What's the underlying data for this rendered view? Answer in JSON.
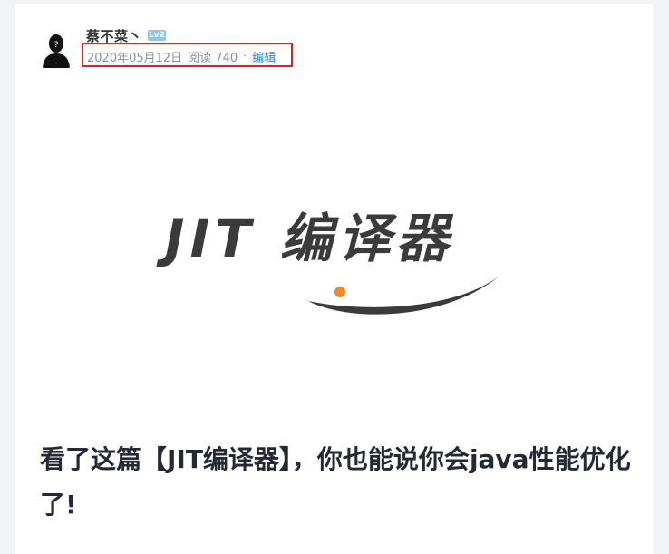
{
  "author": {
    "name": "蔡不菜丶",
    "level_badge": "Lv2"
  },
  "meta": {
    "date": "2020年05月12日",
    "views_label": "阅读 740",
    "separator": "·",
    "edit_label": "编辑"
  },
  "cover": {
    "title_text": "JIT 编译器",
    "accent_color": "#f08a24",
    "ink_color": "#3b3b3b"
  },
  "article": {
    "title": "看了这篇【JIT编译器】，你也能说你会java性能优化了!"
  }
}
